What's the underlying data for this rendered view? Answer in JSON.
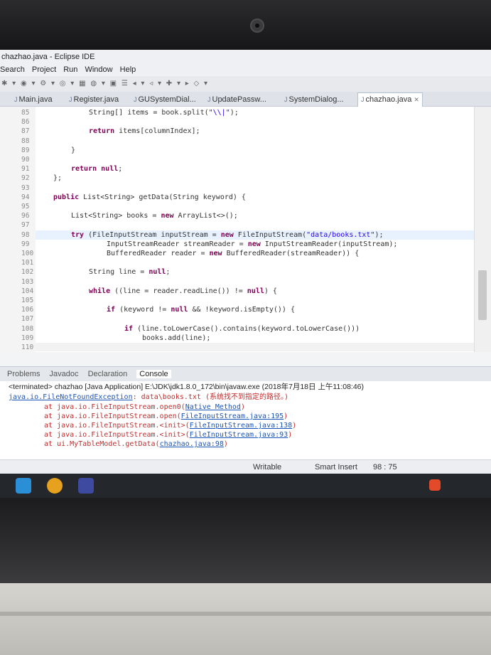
{
  "window": {
    "title": "chazhao.java - Eclipse IDE"
  },
  "menu": [
    "Search",
    "Project",
    "Run",
    "Window",
    "Help"
  ],
  "tabs": [
    {
      "label": "Main.java",
      "active": false
    },
    {
      "label": "Register.java",
      "active": false
    },
    {
      "label": "GUSystemDial...",
      "active": false
    },
    {
      "label": "UpdatePassw...",
      "active": false
    },
    {
      "label": "SystemDialog...",
      "active": false
    },
    {
      "label": "chazhao.java",
      "active": true
    }
  ],
  "code_lines": [
    {
      "n": "85",
      "indent": 2,
      "text": "String[] items = book.split(\"\\\\|\");"
    },
    {
      "n": "86",
      "indent": 0,
      "text": ""
    },
    {
      "n": "87",
      "indent": 2,
      "text": "return items[columnIndex];"
    },
    {
      "n": "88",
      "indent": 0,
      "text": ""
    },
    {
      "n": "89",
      "indent": 1,
      "text": "}"
    },
    {
      "n": "90",
      "indent": 0,
      "text": ""
    },
    {
      "n": "91",
      "indent": 1,
      "text": "return null;"
    },
    {
      "n": "92",
      "indent": 0,
      "text": "};"
    },
    {
      "n": "93",
      "indent": 0,
      "text": ""
    },
    {
      "n": "94",
      "indent": 0,
      "text": "public List<String> getData(String keyword) {"
    },
    {
      "n": "95",
      "indent": 0,
      "text": ""
    },
    {
      "n": "96",
      "indent": 1,
      "text": "List<String> books = new ArrayList<>();"
    },
    {
      "n": "97",
      "indent": 0,
      "text": ""
    },
    {
      "n": "98",
      "indent": 1,
      "text": "try (FileInputStream inputStream = new FileInputStream(\"data/books.txt\");"
    },
    {
      "n": "99",
      "indent": 3,
      "text": "InputStreamReader streamReader = new InputStreamReader(inputStream);"
    },
    {
      "n": "100",
      "indent": 3,
      "text": "BufferedReader reader = new BufferedReader(streamReader)) {"
    },
    {
      "n": "101",
      "indent": 0,
      "text": ""
    },
    {
      "n": "102",
      "indent": 2,
      "text": "String line = null;"
    },
    {
      "n": "103",
      "indent": 0,
      "text": ""
    },
    {
      "n": "104",
      "indent": 2,
      "text": "while ((line = reader.readLine()) != null) {"
    },
    {
      "n": "105",
      "indent": 0,
      "text": ""
    },
    {
      "n": "106",
      "indent": 3,
      "text": "if (keyword != null && !keyword.isEmpty()) {"
    },
    {
      "n": "107",
      "indent": 0,
      "text": ""
    },
    {
      "n": "108",
      "indent": 4,
      "text": "if (line.toLowerCase().contains(keyword.toLowerCase()))"
    },
    {
      "n": "109",
      "indent": 5,
      "text": "books.add(line);"
    },
    {
      "n": "110",
      "indent": 0,
      "text": ""
    }
  ],
  "console_tabs": [
    "Problems",
    "Javadoc",
    "Declaration",
    "Console"
  ],
  "console": {
    "terminated": "<terminated> chazhao [Java Application] E:\\JDK\\jdk1.8.0_172\\bin\\javaw.exe (2018年7月18日 上午11:08:46)",
    "exception": "java.io.FileNotFoundException",
    "exception_msg": ": data\\books.txt (系统找不到指定的路径。)",
    "stack": [
      {
        "at": "at java.io.FileInputStream.open0(",
        "link": "Native Method",
        "end": ")"
      },
      {
        "at": "at java.io.FileInputStream.open(",
        "link": "FileInputStream.java:195",
        "end": ")"
      },
      {
        "at": "at java.io.FileInputStream.<init>(",
        "link": "FileInputStream.java:138",
        "end": ")"
      },
      {
        "at": "at java.io.FileInputStream.<init>(",
        "link": "FileInputStream.java:93",
        "end": ")"
      },
      {
        "at": "at ui.MyTableModel.getData(",
        "link": "chazhao.java:98",
        "end": ")"
      }
    ]
  },
  "status": {
    "writable": "Writable",
    "insert": "Smart Insert",
    "position": "98 : 75"
  },
  "colors": {
    "keyword": "#7f0055",
    "string": "#2a00ff",
    "error": "#c42a2a",
    "link": "#1a55b8"
  }
}
